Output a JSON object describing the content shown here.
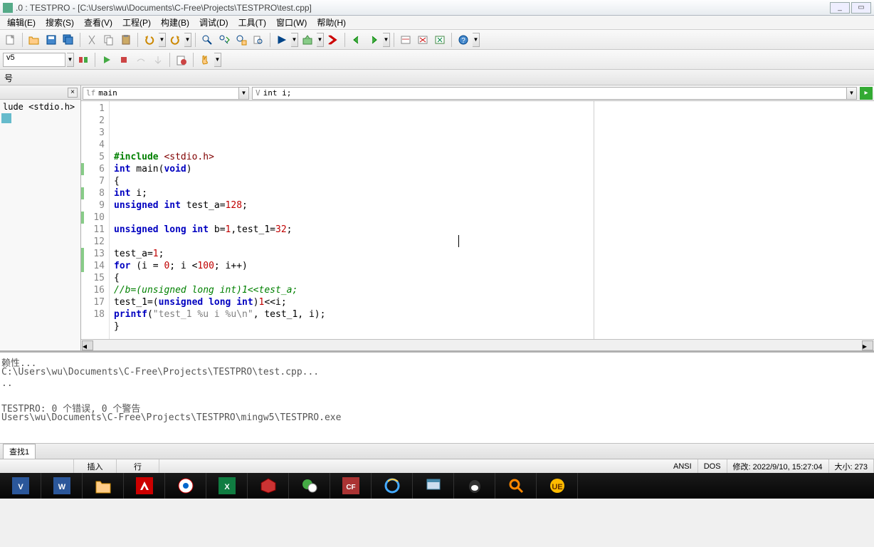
{
  "title": ".0 : TESTPRO - [C:\\Users\\wu\\Documents\\C-Free\\Projects\\TESTPRO\\test.cpp]",
  "menu": [
    "编辑(E)",
    "搜索(S)",
    "查看(V)",
    "工程(P)",
    "构建(B)",
    "调试(D)",
    "工具(T)",
    "窗口(W)",
    "帮助(H)"
  ],
  "toolbar2": {
    "compiler": "v5"
  },
  "side": {
    "header": "号",
    "tree_item": "lude <stdio.h>"
  },
  "editor": {
    "combo1_prefix": "lf",
    "combo1": "main",
    "combo2_prefix": "V",
    "combo2": "int i;",
    "code": [
      {
        "n": 1,
        "tokens": [
          {
            "t": "#include ",
            "c": "pp"
          },
          {
            "t": "<stdio.h>",
            "c": "ppval"
          }
        ]
      },
      {
        "n": 2,
        "tokens": [
          {
            "t": "int",
            "c": "kw"
          },
          {
            "t": " main(",
            "c": ""
          },
          {
            "t": "void",
            "c": "kw"
          },
          {
            "t": ")",
            "c": ""
          }
        ]
      },
      {
        "n": 3,
        "tokens": [
          {
            "t": "{",
            "c": ""
          }
        ]
      },
      {
        "n": 4,
        "tokens": [
          {
            "t": "int",
            "c": "kw"
          },
          {
            "t": " i;",
            "c": ""
          }
        ]
      },
      {
        "n": 5,
        "mark": true,
        "tokens": [
          {
            "t": "unsigned int",
            "c": "kw"
          },
          {
            "t": " test_a=",
            "c": ""
          },
          {
            "t": "128",
            "c": "num"
          },
          {
            "t": ";",
            "c": ""
          }
        ]
      },
      {
        "n": 6,
        "tokens": []
      },
      {
        "n": 7,
        "mark": true,
        "tokens": [
          {
            "t": "unsigned long int",
            "c": "kw"
          },
          {
            "t": " b=",
            "c": ""
          },
          {
            "t": "1",
            "c": "num"
          },
          {
            "t": ",test_1=",
            "c": ""
          },
          {
            "t": "32",
            "c": "num"
          },
          {
            "t": ";",
            "c": ""
          }
        ]
      },
      {
        "n": 8,
        "tokens": []
      },
      {
        "n": 9,
        "mark": true,
        "tokens": [
          {
            "t": "test_a=",
            "c": ""
          },
          {
            "t": "1",
            "c": "num"
          },
          {
            "t": ";",
            "c": ""
          }
        ]
      },
      {
        "n": 10,
        "tokens": [
          {
            "t": "for",
            "c": "kw"
          },
          {
            "t": " (i = ",
            "c": ""
          },
          {
            "t": "0",
            "c": "num"
          },
          {
            "t": "; i <",
            "c": ""
          },
          {
            "t": "100",
            "c": "num"
          },
          {
            "t": "; i++)",
            "c": ""
          }
        ]
      },
      {
        "n": 11,
        "tokens": [
          {
            "t": "{",
            "c": ""
          }
        ]
      },
      {
        "n": 12,
        "mark": true,
        "tokens": [
          {
            "t": "//b=(unsigned long int)1<<test_a;",
            "c": "cmt"
          }
        ]
      },
      {
        "n": 13,
        "mark": true,
        "tokens": [
          {
            "t": "test_1=(",
            "c": ""
          },
          {
            "t": "unsigned long int",
            "c": "kw"
          },
          {
            "t": ")",
            "c": ""
          },
          {
            "t": "1",
            "c": "num"
          },
          {
            "t": "<<i;",
            "c": ""
          }
        ]
      },
      {
        "n": 14,
        "tokens": [
          {
            "t": "printf",
            "c": "kw"
          },
          {
            "t": "(",
            "c": ""
          },
          {
            "t": "\"test_1 %u i %u\\n\"",
            "c": "str"
          },
          {
            "t": ", test_1, i);",
            "c": ""
          }
        ]
      },
      {
        "n": 15,
        "tokens": [
          {
            "t": "}",
            "c": ""
          }
        ]
      },
      {
        "n": 16,
        "tokens": []
      },
      {
        "n": 17,
        "tokens": [
          {
            "t": "}",
            "c": ""
          }
        ]
      },
      {
        "n": 18,
        "tokens": []
      }
    ]
  },
  "output": [
    "赖性...",
    "C:\\Users\\wu\\Documents\\C-Free\\Projects\\TESTPRO\\test.cpp...",
    "..",
    "",
    "TESTPRO: 0 个错误, 0 个警告",
    "Users\\wu\\Documents\\C-Free\\Projects\\TESTPRO\\mingw5\\TESTPRO.exe"
  ],
  "bottom_tabs": [
    "查找1"
  ],
  "status": {
    "insert": "插入",
    "line": "行",
    "encoding": "ANSI",
    "os": "DOS",
    "modified": "修改: 2022/9/10, 15:27:04",
    "size": "大小: 273"
  }
}
